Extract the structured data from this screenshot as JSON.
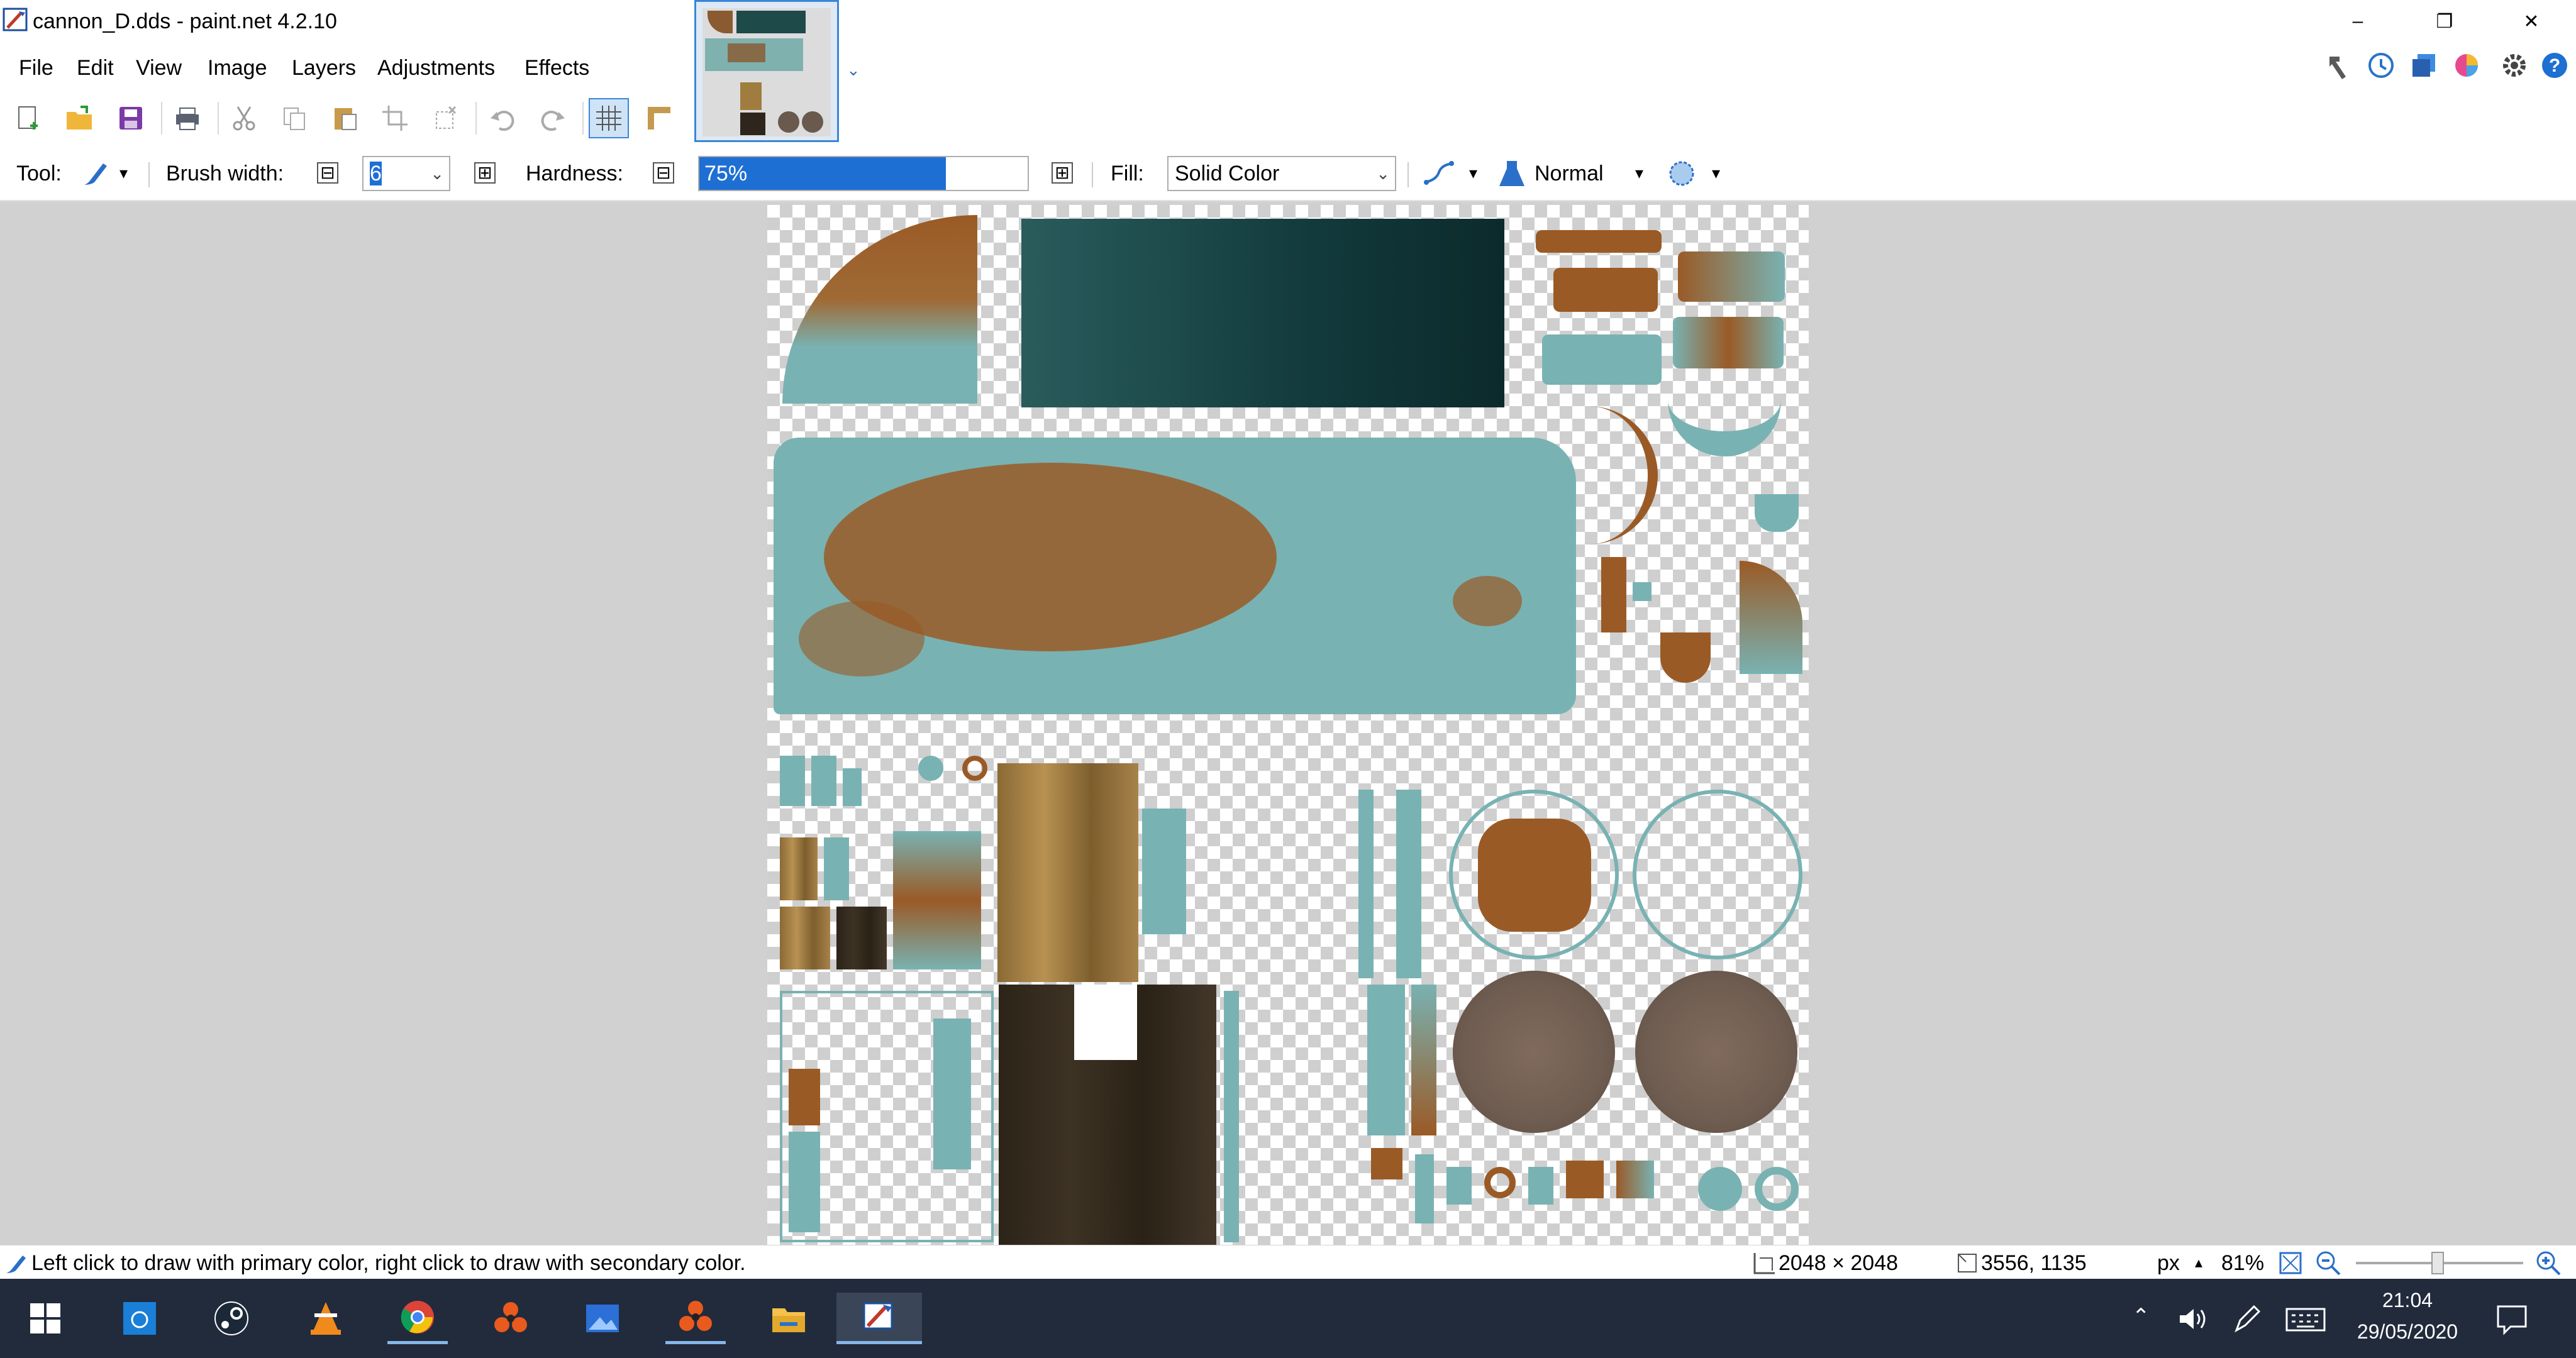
{
  "window": {
    "title": "cannon_D.dds - paint.net 4.2.10",
    "minimize": "–",
    "restore": "❐",
    "close": "✕"
  },
  "menu": {
    "items": [
      "File",
      "Edit",
      "View",
      "Image",
      "Layers",
      "Adjustments",
      "Effects"
    ]
  },
  "options": {
    "tool_label": "Tool:",
    "brush_width_label": "Brush width:",
    "brush_width_value": "6",
    "hardness_label": "Hardness:",
    "hardness_value": "75%",
    "hardness_fraction": 0.75,
    "fill_label": "Fill:",
    "fill_value": "Solid Color",
    "blend_mode": "Normal",
    "minus": "⊟",
    "plus": "⊞"
  },
  "status": {
    "hint": "Left click to draw with primary color, right click to draw with secondary color.",
    "image_size": "2048 × 2048",
    "cursor_pos": "3556, 1135",
    "units": "px",
    "zoom": "81%",
    "zoom_slider_fraction": 0.45
  },
  "taskbar": {
    "time": "21:04",
    "date": "29/05/2020",
    "icons": [
      "windows-start-icon",
      "store-icon",
      "steam-icon",
      "vlc-icon",
      "chrome-icon",
      "app-orange-icon",
      "photos-icon",
      "app-orange-2-icon",
      "file-explorer-icon",
      "paintnet-icon"
    ]
  },
  "colors": {
    "accent": "#3a86d8",
    "taskbar_bg": "#212b3c",
    "workspace_bg": "#d1d1d1",
    "teal_paint": "#79b2b2",
    "rust": "#9a5a26"
  }
}
